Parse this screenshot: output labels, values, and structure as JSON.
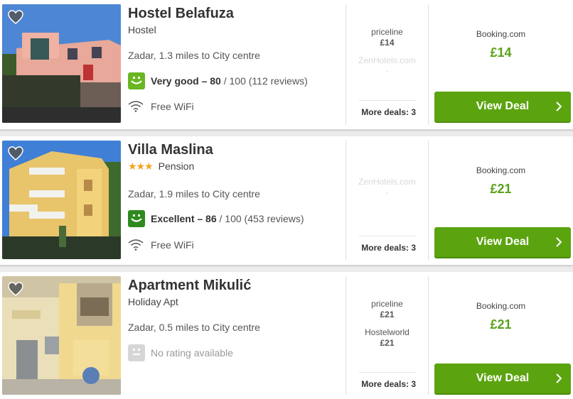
{
  "colors": {
    "accent_green": "#5ba40f",
    "price_green": "#5ba11a",
    "rating_good": "#6ab623",
    "rating_excellent": "#2f8a1e",
    "star": "#f3a420"
  },
  "results": [
    {
      "name": "Hostel Belafuza",
      "type": "Hostel",
      "stars": "",
      "location": "Zadar, 1.3 miles to City centre",
      "rating_label": "Very good – 80",
      "rating_of": " / 100 (112 reviews)",
      "amenity": "Free WiFi",
      "deals": [
        {
          "site": "priceline",
          "price": "£14"
        },
        {
          "site": "ZenHotels.com",
          "price": "-"
        }
      ],
      "more_deals": "More deals: 3",
      "best_site": "Booking.com",
      "best_price": "£14",
      "cta": "View Deal"
    },
    {
      "name": "Villa Maslina",
      "type": "Pension",
      "stars": "★★★",
      "location": "Zadar, 1.9 miles to City centre",
      "rating_label": "Excellent – 86",
      "rating_of": " / 100 (453 reviews)",
      "amenity": "Free WiFi",
      "deals": [
        {
          "site": "ZenHotels.com",
          "price": "-"
        }
      ],
      "more_deals": "More deals: 3",
      "best_site": "Booking.com",
      "best_price": "£21",
      "cta": "View Deal"
    },
    {
      "name": "Apartment Mikulić",
      "type": "Holiday Apt",
      "stars": "",
      "location": "Zadar, 0.5 miles to City centre",
      "rating_none": "No rating available",
      "deals": [
        {
          "site": "priceline",
          "price": "£21"
        },
        {
          "site": "Hostelworld",
          "price": "£21"
        }
      ],
      "more_deals": "More deals: 3",
      "best_site": "Booking.com",
      "best_price": "£21",
      "cta": "View Deal"
    }
  ]
}
